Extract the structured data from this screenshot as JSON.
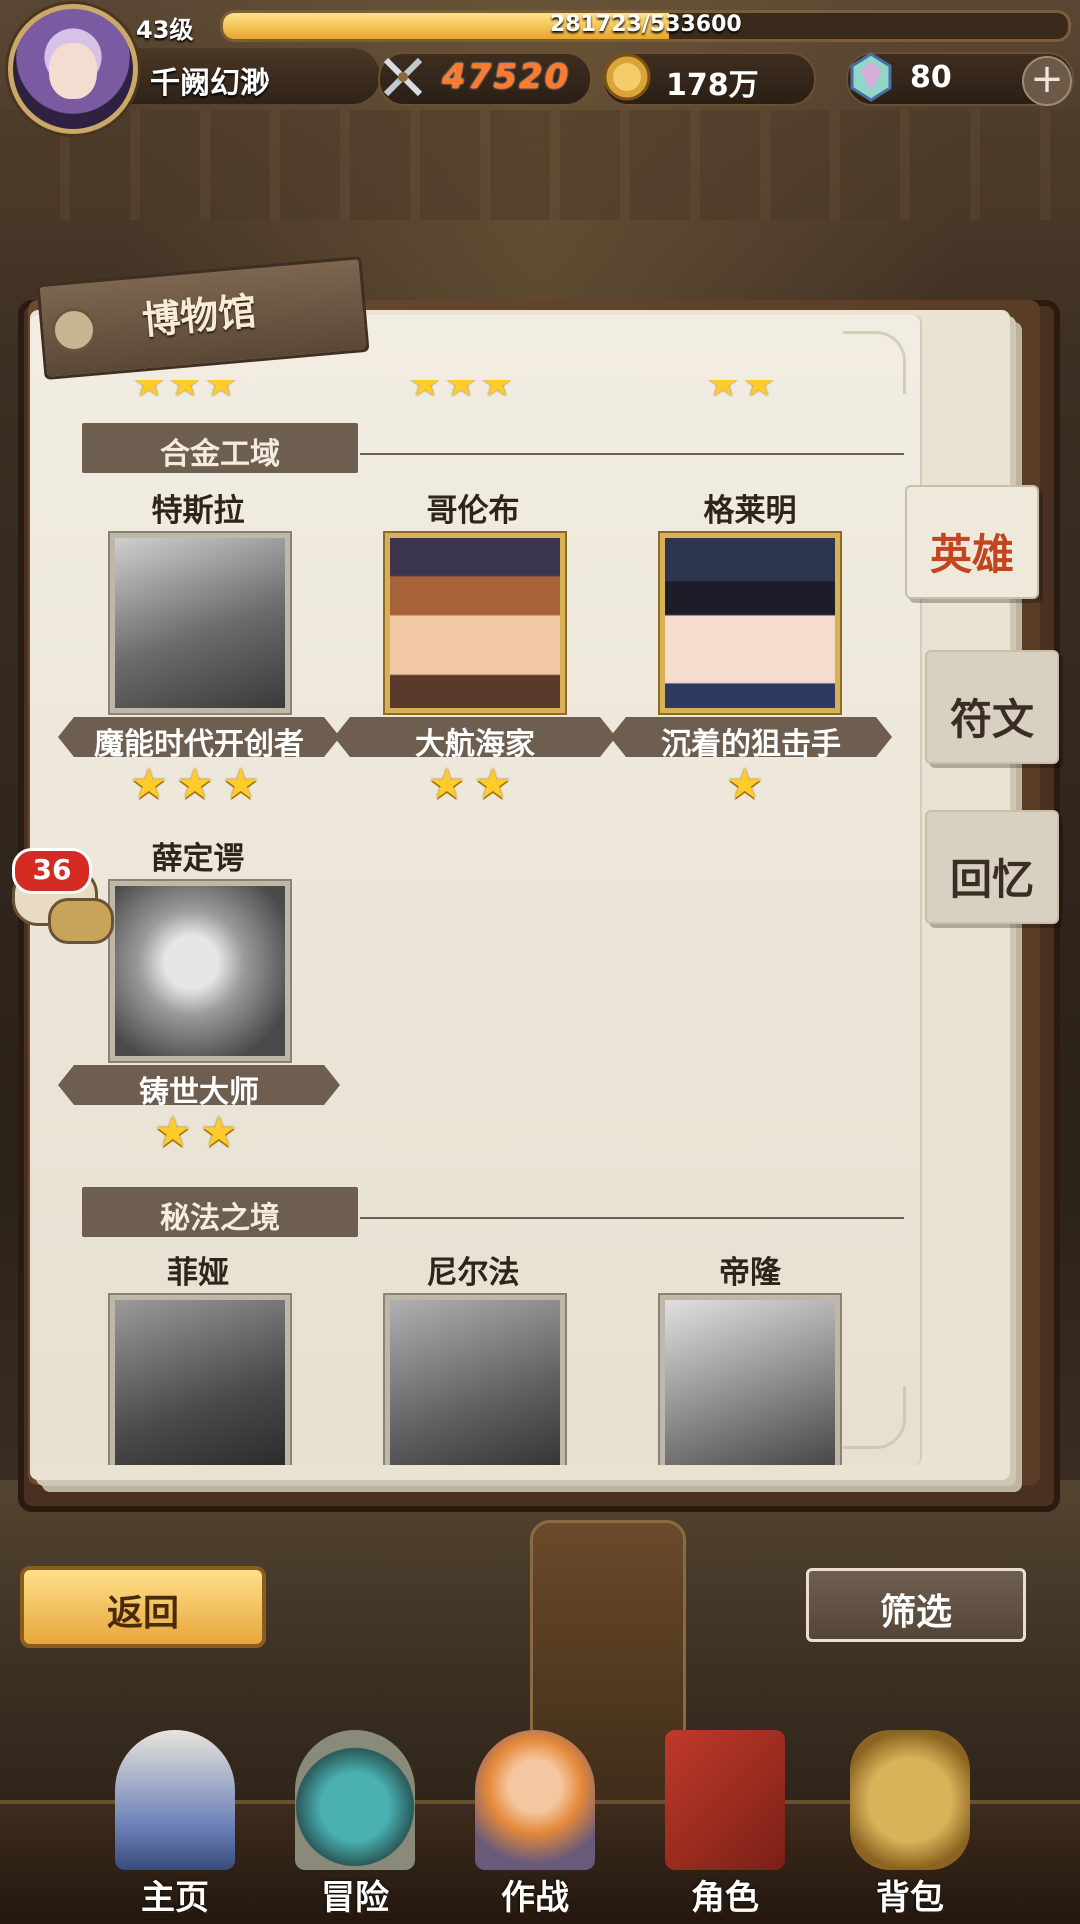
{
  "player": {
    "level": "43级",
    "name": "千阙幻渺",
    "xp": "281723/533600",
    "xp_progress": 0.528
  },
  "resources": {
    "power": "47520",
    "gold": "178万",
    "gems": "80"
  },
  "museum": {
    "title": "博物馆",
    "sections": [
      {
        "name": "合金工域",
        "heroes": [
          {
            "name": "特斯拉",
            "title": "魔能时代开创者",
            "stars": 3
          },
          {
            "name": "哥伦布",
            "title": "大航海家",
            "stars": 2
          },
          {
            "name": "格莱明",
            "title": "沉着的狙击手",
            "stars": 1
          },
          {
            "name": "薛定谔",
            "title": "铸世大师",
            "stars": 2
          }
        ]
      },
      {
        "name": "秘法之境",
        "heroes": [
          {
            "name": "菲娅"
          },
          {
            "name": "尼尔法"
          },
          {
            "name": "帝隆"
          }
        ]
      }
    ]
  },
  "tabs": {
    "heroes": "英雄",
    "runes": "符文",
    "memories": "回忆"
  },
  "chat_badge": "36",
  "buttons": {
    "back": "返回",
    "filter": "筛选"
  },
  "nav": {
    "home": "主页",
    "adventure": "冒险",
    "battle": "作战",
    "character": "角色",
    "bag": "背包"
  },
  "colors": {
    "active_tab": "#c2451f",
    "star": "#ffcc2a",
    "gold_button": "#e7a73b"
  }
}
